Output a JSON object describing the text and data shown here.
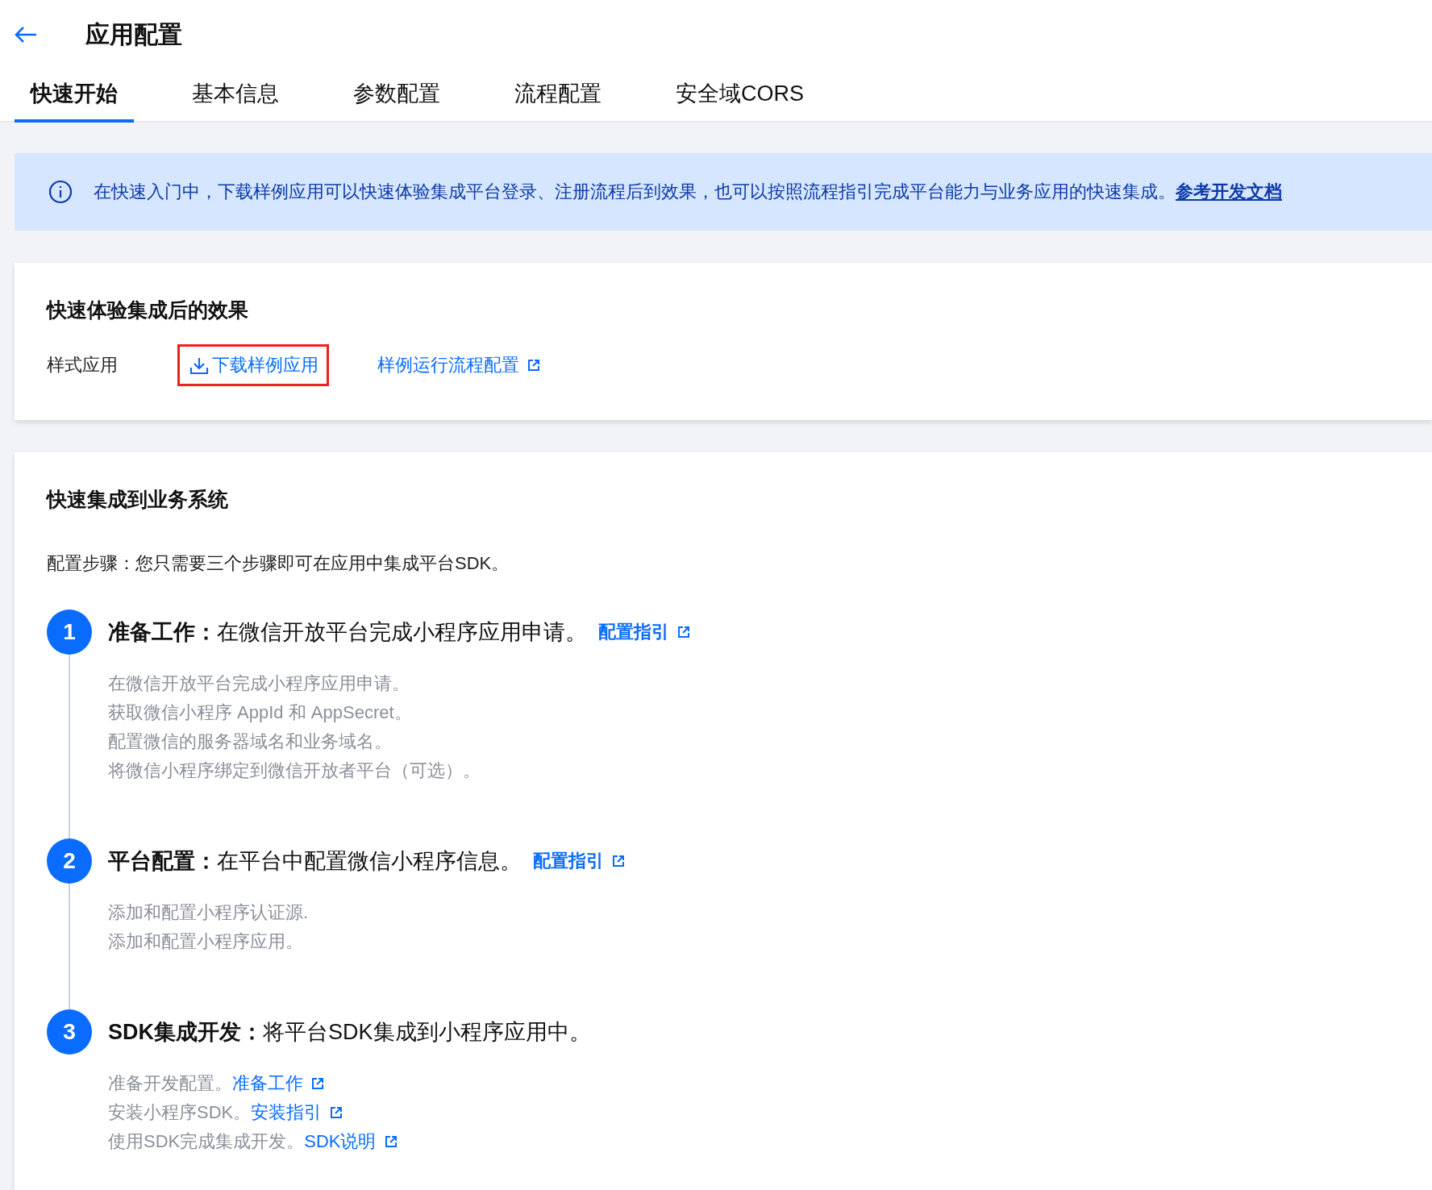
{
  "header": {
    "title": "应用配置"
  },
  "tabs": [
    {
      "label": "快速开始",
      "selected": true
    },
    {
      "label": "基本信息",
      "selected": false
    },
    {
      "label": "参数配置",
      "selected": false
    },
    {
      "label": "流程配置",
      "selected": false
    },
    {
      "label": "安全域CORS",
      "selected": false
    }
  ],
  "notice": {
    "text": "在快速入门中，下载样例应用可以快速体验集成平台登录、注册流程后到效果，也可以按照流程指引完成平台能力与业务应用的快速集成。",
    "link": "参考开发文档"
  },
  "demo_card": {
    "title": "快速体验集成后的效果",
    "label": "样式应用",
    "download_link": {
      "label": "下载样例应用",
      "highlighted": true
    },
    "flow_link": "样例运行流程配置"
  },
  "integration_card": {
    "title": "快速集成到业务系统",
    "intro": "配置步骤：您只需要三个步骤即可在应用中集成平台SDK。",
    "steps": [
      {
        "number": "1",
        "heading": "**准备工作：**在微信开放平台完成小程序应用申请。",
        "link": "配置指引",
        "lines": [
          {
            "text": "在微信开放平台完成小程序应用申请。"
          },
          {
            "text": "获取微信小程序 AppId 和 AppSecret。"
          },
          {
            "text": "配置微信的服务器域名和业务域名。"
          },
          {
            "text": "将微信小程序绑定到微信开放者平台（可选）。"
          }
        ]
      },
      {
        "number": "2",
        "heading": "**平台配置：**在平台中配置微信小程序信息。",
        "link": "配置指引",
        "lines": [
          {
            "text": "添加和配置小程序认证源."
          },
          {
            "text": "添加和配置小程序应用。"
          }
        ]
      },
      {
        "number": "3",
        "heading": "**SDK集成开发：**将平台SDK集成到小程序应用中。",
        "lines": [
          {
            "text": "准备开发配置。",
            "link": "准备工作"
          },
          {
            "text": "安装小程序SDK。",
            "link": "安装指引"
          },
          {
            "text": "使用SDK完成集成开发。",
            "link": "SDK说明"
          }
        ]
      }
    ]
  }
}
